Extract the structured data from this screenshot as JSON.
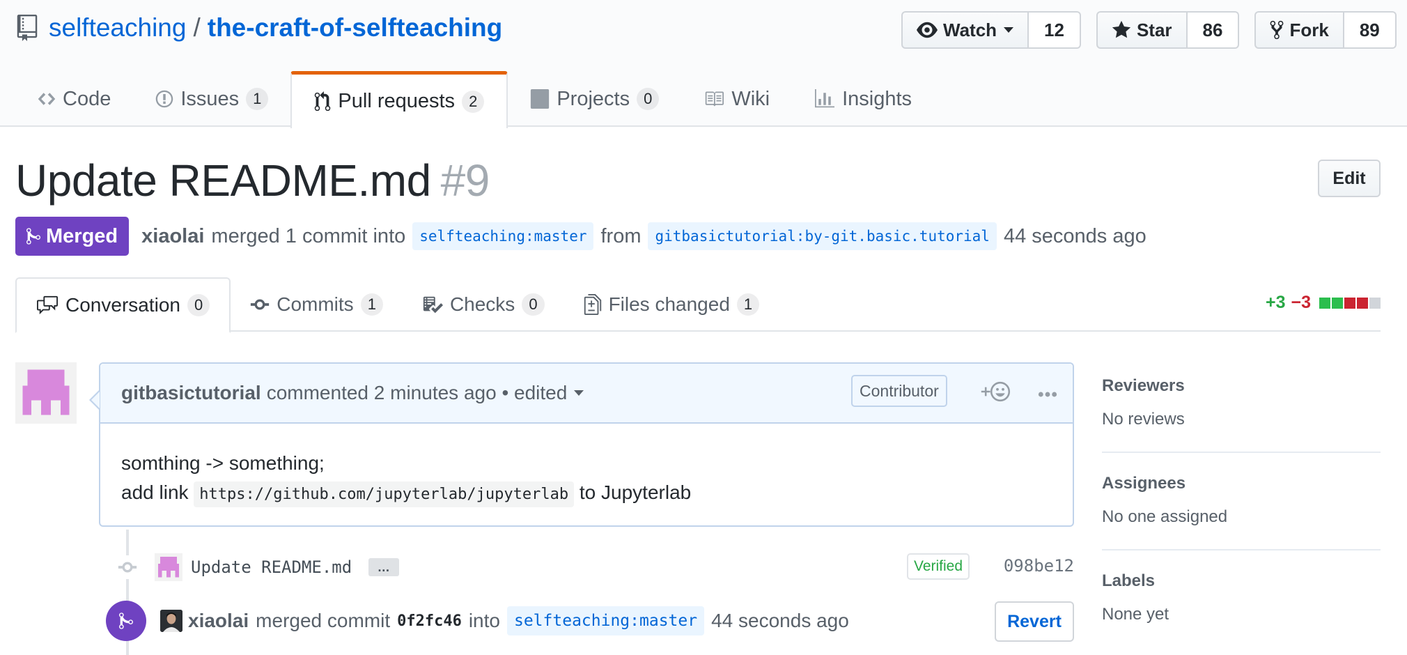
{
  "repo": {
    "owner": "selfteaching",
    "separator": "/",
    "name": "the-craft-of-selfteaching"
  },
  "actions": {
    "watch": {
      "label": "Watch",
      "count": "12"
    },
    "star": {
      "label": "Star",
      "count": "86"
    },
    "fork": {
      "label": "Fork",
      "count": "89"
    }
  },
  "nav": {
    "code": {
      "label": "Code"
    },
    "issues": {
      "label": "Issues",
      "count": "1"
    },
    "pulls": {
      "label": "Pull requests",
      "count": "2"
    },
    "projects": {
      "label": "Projects",
      "count": "0"
    },
    "wiki": {
      "label": "Wiki"
    },
    "insights": {
      "label": "Insights"
    }
  },
  "pr": {
    "title": "Update README.md",
    "number": "#9",
    "edit_label": "Edit",
    "state": "Merged",
    "merger": "xiaolai",
    "merged_text": "merged 1 commit into",
    "base_user": "selfteaching",
    "base_branch": "master",
    "from_text": "from",
    "head_user": "gitbasictutorial",
    "head_branch": "by-git.basic.tutorial",
    "time": "44 seconds ago"
  },
  "tabs": {
    "conversation": {
      "label": "Conversation",
      "count": "0"
    },
    "commits": {
      "label": "Commits",
      "count": "1"
    },
    "checks": {
      "label": "Checks",
      "count": "0"
    },
    "files": {
      "label": "Files changed",
      "count": "1"
    }
  },
  "diffstat": {
    "additions": "+3",
    "deletions": "−3"
  },
  "comment": {
    "author": "gitbasictutorial",
    "action": "commented",
    "time": "2 minutes ago",
    "edited": "• edited",
    "role": "Contributor",
    "line1": "somthing -> something;",
    "line2_prefix": "add link",
    "line2_code": "https://github.com/jupyterlab/jupyterlab",
    "line2_suffix": "to Jupyterlab"
  },
  "commit": {
    "message": "Update README.md",
    "ellipsis": "…",
    "verified": "Verified",
    "sha": "098be12"
  },
  "merge_event": {
    "author": "xiaolai",
    "action": "merged commit",
    "sha": "0f2fc46",
    "into": "into",
    "base_user": "selfteaching",
    "base_branch": "master",
    "time": "44 seconds ago",
    "revert_label": "Revert"
  },
  "sidebar": {
    "reviewers": {
      "heading": "Reviewers",
      "value": "No reviews"
    },
    "assignees": {
      "heading": "Assignees",
      "value": "No one assigned"
    },
    "labels": {
      "heading": "Labels",
      "value": "None yet"
    }
  },
  "colors": {
    "link": "#0366d6",
    "merged": "#6f42c1",
    "tab_accent": "#e36209",
    "addition": "#28a745",
    "deletion": "#cb2431"
  }
}
